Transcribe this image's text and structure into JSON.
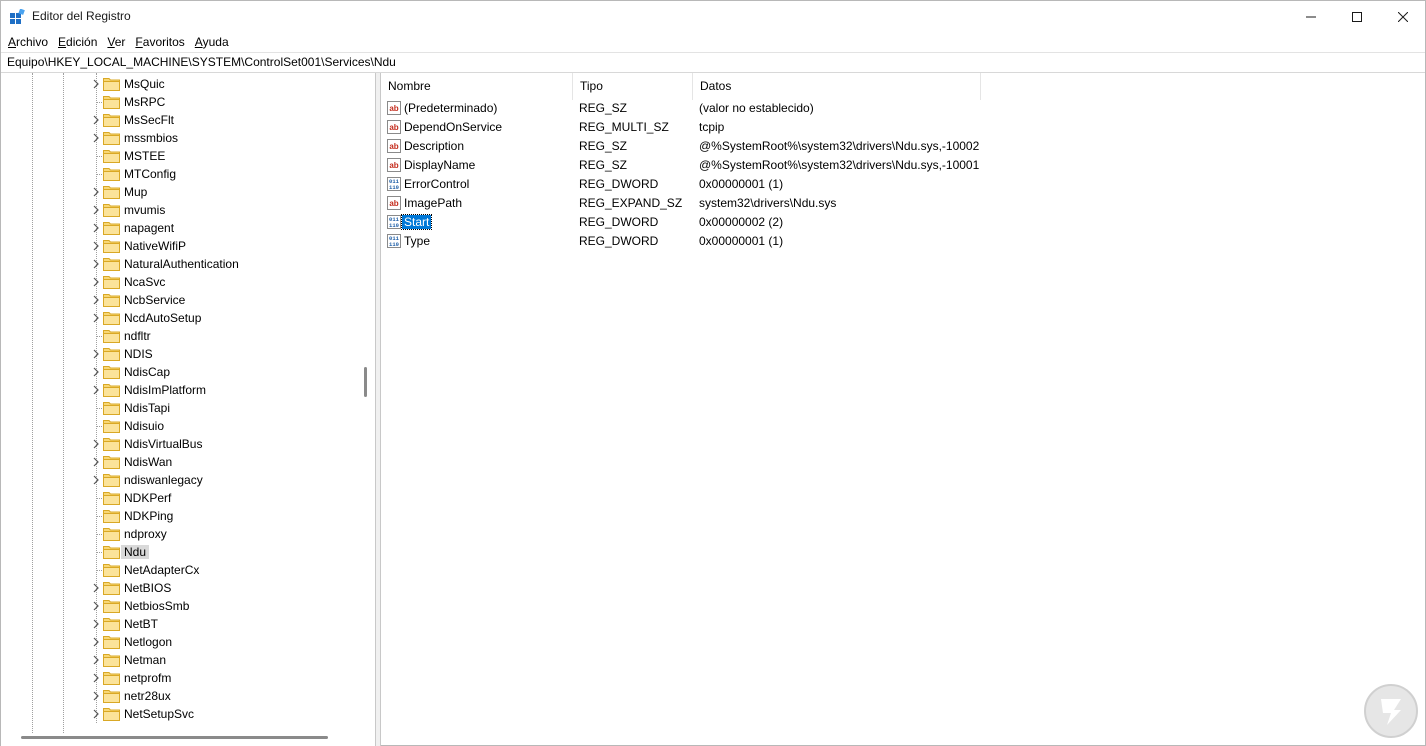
{
  "window": {
    "title": "Editor del Registro",
    "icon": "regedit-icon"
  },
  "menu": {
    "items": [
      {
        "label": "Archivo",
        "underline": "A",
        "rest": "rchivo"
      },
      {
        "label": "Edición",
        "underline": "E",
        "rest": "dición"
      },
      {
        "label": "Ver",
        "underline": "V",
        "rest": "er"
      },
      {
        "label": "Favoritos",
        "underline": "F",
        "rest": "avoritos"
      },
      {
        "label": "Ayuda",
        "underline": "A",
        "rest": "yuda"
      }
    ]
  },
  "address": {
    "path": "Equipo\\HKEY_LOCAL_MACHINE\\SYSTEM\\ControlSet001\\Services\\Ndu"
  },
  "tree": {
    "items": [
      {
        "label": "MsQuic",
        "expandable": true
      },
      {
        "label": "MsRPC",
        "expandable": false
      },
      {
        "label": "MsSecFlt",
        "expandable": true
      },
      {
        "label": "mssmbios",
        "expandable": true
      },
      {
        "label": "MSTEE",
        "expandable": false
      },
      {
        "label": "MTConfig",
        "expandable": false
      },
      {
        "label": "Mup",
        "expandable": true
      },
      {
        "label": "mvumis",
        "expandable": true
      },
      {
        "label": "napagent",
        "expandable": true
      },
      {
        "label": "NativeWifiP",
        "expandable": true
      },
      {
        "label": "NaturalAuthentication",
        "expandable": true
      },
      {
        "label": "NcaSvc",
        "expandable": true
      },
      {
        "label": "NcbService",
        "expandable": true
      },
      {
        "label": "NcdAutoSetup",
        "expandable": true
      },
      {
        "label": "ndfltr",
        "expandable": false
      },
      {
        "label": "NDIS",
        "expandable": true
      },
      {
        "label": "NdisCap",
        "expandable": true
      },
      {
        "label": "NdisImPlatform",
        "expandable": true
      },
      {
        "label": "NdisTapi",
        "expandable": false
      },
      {
        "label": "Ndisuio",
        "expandable": false
      },
      {
        "label": "NdisVirtualBus",
        "expandable": true
      },
      {
        "label": "NdisWan",
        "expandable": true
      },
      {
        "label": "ndiswanlegacy",
        "expandable": true
      },
      {
        "label": "NDKPerf",
        "expandable": false
      },
      {
        "label": "NDKPing",
        "expandable": false
      },
      {
        "label": "ndproxy",
        "expandable": false
      },
      {
        "label": "Ndu",
        "expandable": false,
        "selected": true
      },
      {
        "label": "NetAdapterCx",
        "expandable": false
      },
      {
        "label": "NetBIOS",
        "expandable": true
      },
      {
        "label": "NetbiosSmb",
        "expandable": true
      },
      {
        "label": "NetBT",
        "expandable": true
      },
      {
        "label": "Netlogon",
        "expandable": true
      },
      {
        "label": "Netman",
        "expandable": true
      },
      {
        "label": "netprofm",
        "expandable": true
      },
      {
        "label": "netr28ux",
        "expandable": true
      },
      {
        "label": "NetSetupSvc",
        "expandable": true
      }
    ]
  },
  "values": {
    "columns": {
      "name": "Nombre",
      "type": "Tipo",
      "data": "Datos"
    },
    "rows": [
      {
        "name": "(Predeterminado)",
        "type": "REG_SZ",
        "data": "(valor no establecido)",
        "icon": "string-value-icon"
      },
      {
        "name": "DependOnService",
        "type": "REG_MULTI_SZ",
        "data": "tcpip",
        "icon": "string-value-icon"
      },
      {
        "name": "Description",
        "type": "REG_SZ",
        "data": "@%SystemRoot%\\system32\\drivers\\Ndu.sys,-10002",
        "icon": "string-value-icon"
      },
      {
        "name": "DisplayName",
        "type": "REG_SZ",
        "data": "@%SystemRoot%\\system32\\drivers\\Ndu.sys,-10001",
        "icon": "string-value-icon"
      },
      {
        "name": "ErrorControl",
        "type": "REG_DWORD",
        "data": "0x00000001 (1)",
        "icon": "binary-value-icon"
      },
      {
        "name": "ImagePath",
        "type": "REG_EXPAND_SZ",
        "data": "system32\\drivers\\Ndu.sys",
        "icon": "string-value-icon"
      },
      {
        "name": "Start",
        "type": "REG_DWORD",
        "data": "0x00000002 (2)",
        "icon": "binary-value-icon",
        "selected": true
      },
      {
        "name": "Type",
        "type": "REG_DWORD",
        "data": "0x00000001 (1)",
        "icon": "binary-value-icon"
      }
    ]
  },
  "colors": {
    "selection": "#0078d7",
    "tree_selection": "#d9d9d9",
    "folder": "#f8d775"
  }
}
